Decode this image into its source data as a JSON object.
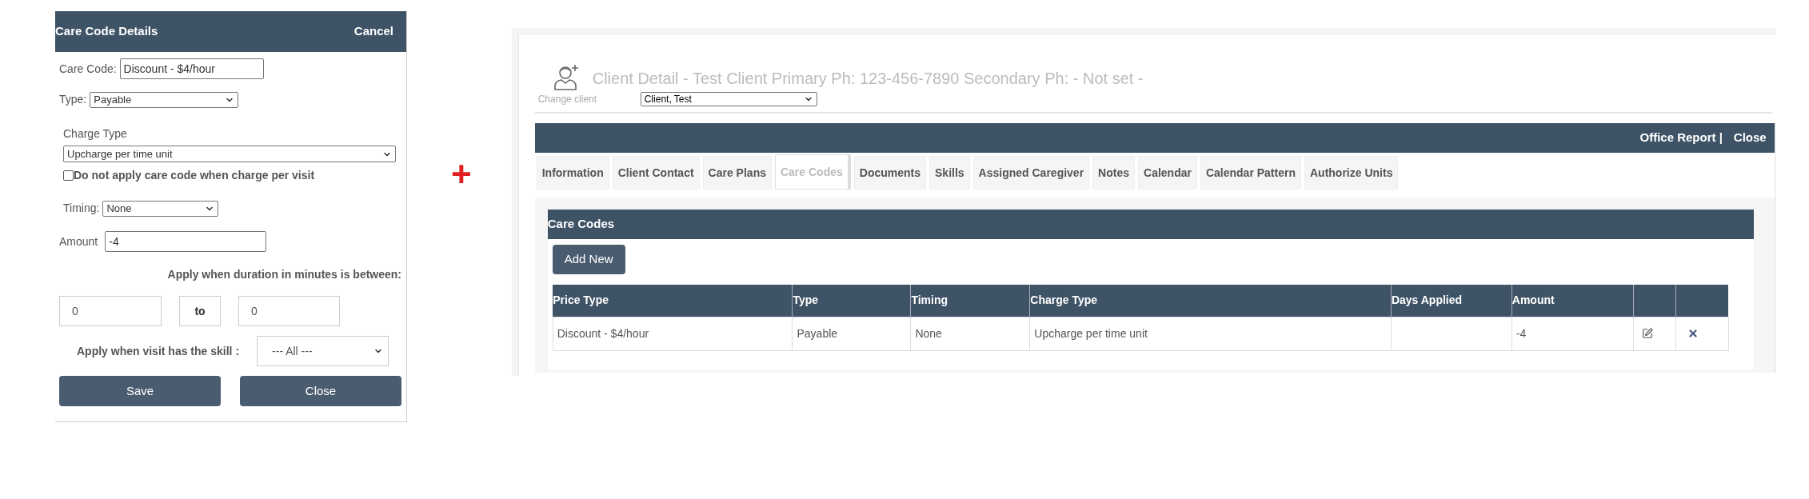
{
  "dialog": {
    "title": "Care Code Details",
    "cancel_link": "Cancel",
    "care_code": {
      "label": "Care Code:",
      "value": "Discount - $4/hour"
    },
    "type": {
      "label": "Type:",
      "value": "Payable"
    },
    "charge_type": {
      "label": "Charge Type",
      "value": "Upcharge per time unit"
    },
    "per_visit_option": {
      "label": "Do not apply care code when charge per visit",
      "checked": false
    },
    "timing": {
      "label": "Timing:",
      "value": "None"
    },
    "amount": {
      "label": "Amount",
      "value": "-4"
    },
    "duration": {
      "label": "Apply when duration in minutes is between:",
      "from": "0",
      "separator": "to",
      "to": "0"
    },
    "skill": {
      "label": "Apply when visit has the skill :",
      "value": "--- All ---"
    },
    "buttons": [
      "Save",
      "Close"
    ]
  },
  "plus_sign": "+",
  "client_detail": {
    "title": "Client Detail - Test Client Primary Ph: 123-456-7890 Secondary Ph: - Not set -",
    "change_client": {
      "label": "Change client",
      "value": "Client, Test"
    },
    "toolbar_links": [
      "Office Report |",
      "Close"
    ],
    "tabs": [
      {
        "label": "Information",
        "selected": false
      },
      {
        "label": "Client Contact",
        "selected": false
      },
      {
        "label": "Care Plans",
        "selected": false
      },
      {
        "label": "Care Codes",
        "selected": true
      },
      {
        "label": "Documents",
        "selected": false
      },
      {
        "label": "Skills",
        "selected": false
      },
      {
        "label": "Assigned Caregiver",
        "selected": false
      },
      {
        "label": "Notes",
        "selected": false
      },
      {
        "label": "Calendar",
        "selected": false
      },
      {
        "label": "Calendar Pattern",
        "selected": false
      },
      {
        "label": "Authorize Units",
        "selected": false
      }
    ],
    "care_codes": {
      "title": "Care Codes",
      "add_button": "Add New",
      "columns": [
        "Price Type",
        "Type",
        "Timing",
        "Charge Type",
        "Days Applied",
        "Amount"
      ],
      "rows": [
        {
          "price_type": "Discount - $4/hour",
          "type": "Payable",
          "timing": "None",
          "charge_type": "Upcharge per time unit",
          "amount": "-4"
        }
      ]
    }
  }
}
